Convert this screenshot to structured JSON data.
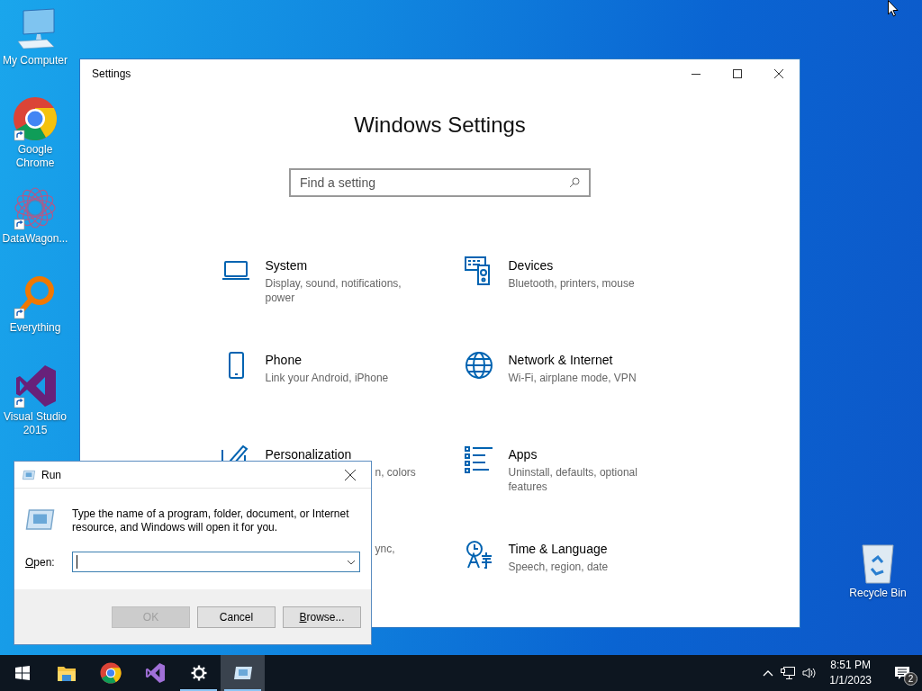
{
  "desktop_icons": [
    {
      "kind": "computer",
      "label": "My Computer",
      "shortcut": false
    },
    {
      "kind": "chrome",
      "label": "Google Chrome",
      "shortcut": true
    },
    {
      "kind": "datawagon",
      "label": "DataWagon...",
      "shortcut": true
    },
    {
      "kind": "everything",
      "label": "Everything",
      "shortcut": true
    },
    {
      "kind": "visual-studio",
      "label": "Visual Studio 2015",
      "shortcut": true
    }
  ],
  "recycle_bin": {
    "label": "Recycle Bin"
  },
  "settings_window": {
    "title": "Settings",
    "heading": "Windows Settings",
    "search": {
      "placeholder": "Find a setting"
    },
    "items": [
      {
        "kind": "system",
        "title": "System",
        "subtitle": "Display, sound, notifications, power",
        "covered": false
      },
      {
        "kind": "devices",
        "title": "Devices",
        "subtitle": "Bluetooth, printers, mouse",
        "covered": false
      },
      {
        "kind": "phone",
        "title": "Phone",
        "subtitle": "Link your Android, iPhone",
        "covered": false
      },
      {
        "kind": "network",
        "title": "Network & Internet",
        "subtitle": "Wi-Fi, airplane mode, VPN",
        "covered": false
      },
      {
        "kind": "personalization",
        "title": "Personalization",
        "subtitle": "n, colors",
        "covered": true
      },
      {
        "kind": "apps",
        "title": "Apps",
        "subtitle": "Uninstall, defaults, optional features",
        "covered": false
      },
      {
        "kind": "accounts",
        "subtitle": "ync,",
        "covered": true
      },
      {
        "kind": "time-language",
        "title": "Time & Language",
        "subtitle": "Speech, region, date",
        "covered": false
      }
    ]
  },
  "run_dialog": {
    "title": "Run",
    "message": "Type the name of a program, folder, document, or Internet resource, and Windows will open it for you.",
    "open_label": {
      "text": "Open:",
      "mnemonic": true
    },
    "open_field": {
      "focused": true
    },
    "buttons": [
      {
        "label": "OK",
        "disabled": true,
        "mnemonic": false
      },
      {
        "label": "Cancel",
        "disabled": false,
        "mnemonic": false
      },
      {
        "label": "Browse...",
        "disabled": false,
        "mnemonic": true
      }
    ]
  },
  "taskbar": {
    "apps": [
      {
        "kind": "start",
        "running": false,
        "active": false
      },
      {
        "kind": "explorer",
        "running": false,
        "active": false
      },
      {
        "kind": "chrome",
        "running": false,
        "active": false
      },
      {
        "kind": "visual-studio",
        "running": false,
        "active": false
      },
      {
        "kind": "settings",
        "running": true,
        "active": false
      },
      {
        "kind": "run",
        "running": true,
        "active": true
      }
    ],
    "clock": {
      "time": "8:51 PM",
      "date": "1/1/2023"
    },
    "notification_count": "2"
  }
}
